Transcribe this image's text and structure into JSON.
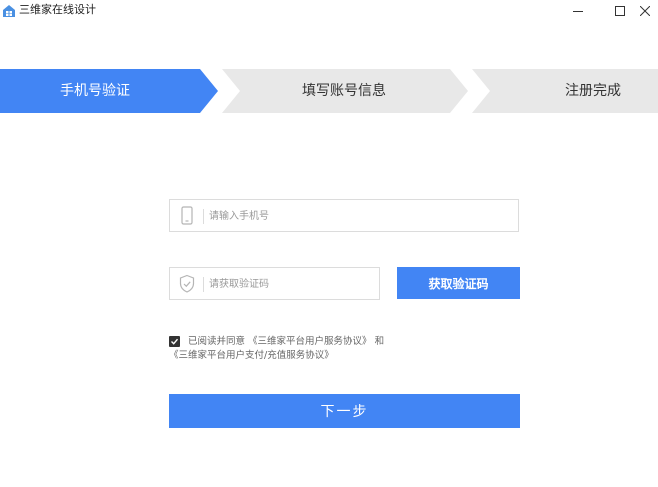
{
  "window": {
    "title": "三维家在线设计",
    "controls": {
      "minimize": "–",
      "maximize": "☐",
      "close": "✕"
    }
  },
  "steps": [
    {
      "label": "手机号验证",
      "active": true
    },
    {
      "label": "填写账号信息",
      "active": false
    },
    {
      "label": "注册完成",
      "active": false
    }
  ],
  "form": {
    "phone": {
      "value": "",
      "placeholder": "请输入手机号"
    },
    "code": {
      "value": "",
      "placeholder": "请获取验证码"
    },
    "get_code_label": "获取验证码",
    "agreement": {
      "checked": true,
      "prefix": "已阅读并同意",
      "link_service": "《三维家平台用户服务协议》",
      "connector": "和",
      "link_payment": "《三维家平台用户支付/充值服务协议》"
    },
    "next_label": "下一步"
  },
  "colors": {
    "accent": "#4285f4",
    "step_inactive": "#e8e8e8"
  }
}
